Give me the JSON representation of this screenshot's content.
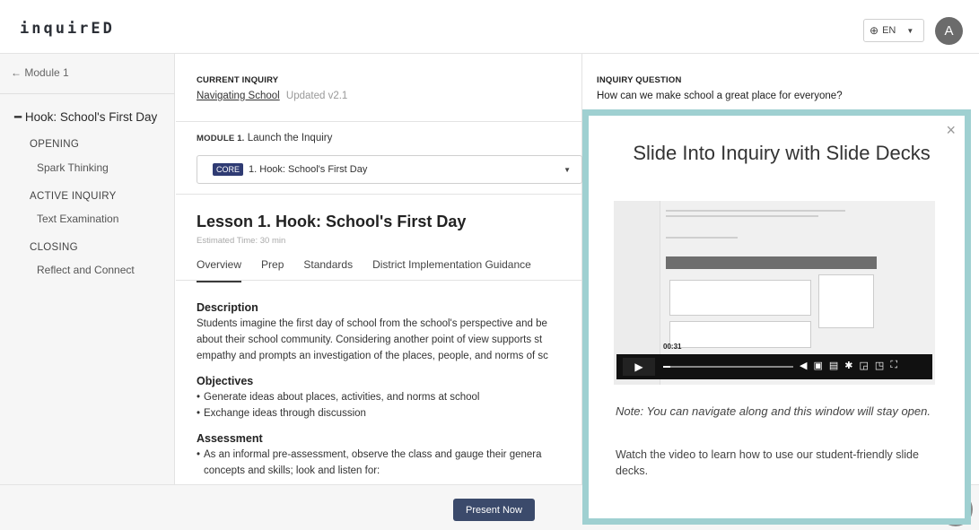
{
  "header": {
    "logo": "inquirED",
    "lang_label": "EN",
    "avatar_initial": "A"
  },
  "sidebar": {
    "back_label": "← Module 1",
    "current_lesson": "Hook: School's First Day",
    "sections": [
      {
        "title": "OPENING",
        "item": "Spark Thinking"
      },
      {
        "title": "ACTIVE INQUIRY",
        "item": "Text Examination"
      },
      {
        "title": "CLOSING",
        "item": "Reflect and Connect"
      }
    ]
  },
  "inquiry": {
    "current_label": "CURRENT INQUIRY",
    "current_name": "Navigating School",
    "current_version": "Updated v2.1",
    "question_label": "INQUIRY QUESTION",
    "question_text": "How can we make school a great place for everyone?"
  },
  "module": {
    "label": "MODULE 1.",
    "name": "Launch the Inquiry",
    "select_badge": "CORE",
    "select_value": "1. Hook: School's First Day"
  },
  "lesson": {
    "title": "Lesson 1. Hook: School's First Day",
    "estimated": "Estimated Time: 30 min",
    "tabs": [
      "Overview",
      "Prep",
      "Standards",
      "District Implementation Guidance"
    ],
    "description_heading": "Description",
    "description_lines": [
      "Students imagine the first day of school from the school's perspective and be",
      "about their school community. Considering another point of view supports st",
      "empathy and prompts an investigation of the places, people, and norms of sc"
    ],
    "objectives_heading": "Objectives",
    "objectives": [
      "Generate ideas about places, activities, and norms at school",
      "Exchange ideas through discussion"
    ],
    "assessment_heading": "Assessment",
    "assessment_lines": [
      "As an informal pre-assessment, observe the class and gauge their genera",
      "concepts and skills; look and listen for:"
    ]
  },
  "footer": {
    "present_label": "Present Now"
  },
  "modal": {
    "close_glyph": "×",
    "title": "Slide Into Inquiry with Slide Decks",
    "video_time": "00:31",
    "note": "Note: You can navigate along and this window will stay open.",
    "body": "Watch the video to learn how to use our student-friendly slide decks."
  },
  "colors": {
    "modal_border": "#9fd0d1",
    "core_badge": "#2f3b73",
    "present_button": "#3b4a6b"
  }
}
